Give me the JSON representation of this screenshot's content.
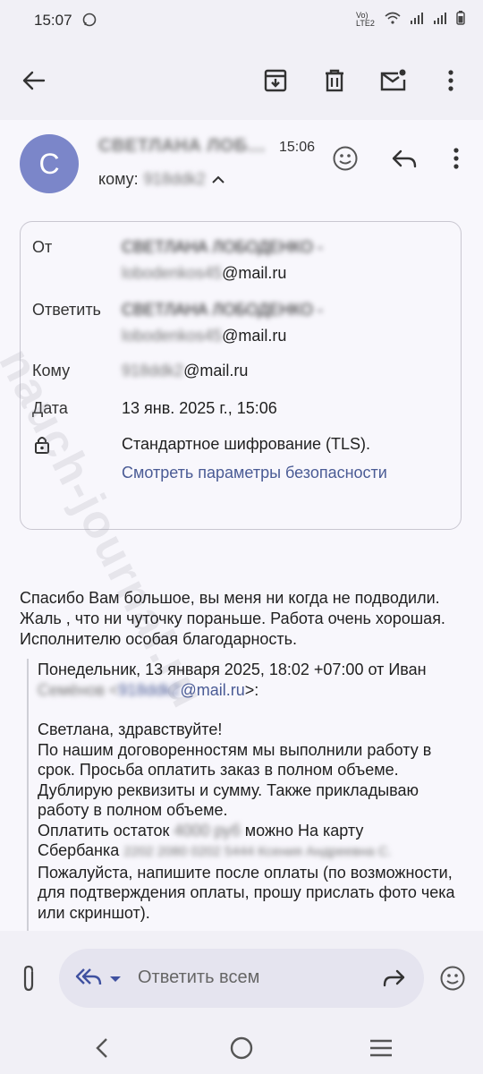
{
  "status": {
    "time": "15:07",
    "network": "Vo) LTE2"
  },
  "email": {
    "sender": "СВЕТЛАНА ЛОБ…",
    "time": "15:06",
    "to_label": "кому:",
    "to_value": "918ddk2",
    "avatar_letter": "С"
  },
  "details": {
    "from_label": "От",
    "from_line1": "СВЕТЛАНА ЛОБОДЕНКО -",
    "from_line2_blur": "lobodenkos45",
    "from_domain": "@mail.ru",
    "reply_label": "Ответить",
    "reply_line1": "СВЕТЛАНА ЛОБОДЕНКО -",
    "reply_line2_blur": "lobodenkos45",
    "reply_domain": "@mail.ru",
    "to_label": "Кому",
    "to_blur": "918ddk2",
    "to_domain": "@mail.ru",
    "date_label": "Дата",
    "date_value": "13 янв. 2025 г., 15:06",
    "encryption": "Стандартное шифрование (TLS).",
    "security_link": "Смотреть параметры безопасности"
  },
  "body": {
    "message": "Спасибо Вам большое, вы меня ни когда не подводили. Жаль , что ни чуточку пораньше. Работа очень хорошая. Исполнителю особая благодарность.",
    "quote_header": "Понедельник, 13 января 2025, 18:02 +07:00 от Иван",
    "quote_name_blur": "Семёнов <",
    "quote_email_blur": "918ddk2",
    "quote_email_domain": "@mail.ru",
    "quote_email_end": ">:",
    "quote_greeting": "Светлана, здравствуйте!",
    "quote_p1": "По нашим договоренностям мы выполнили работу в срок. Просьба оплатить заказ в полном объеме. Дублирую реквизиты и сумму. Также прикладываю работу в полном объеме.",
    "quote_p2_a": "Оплатить остаток",
    "quote_p2_blur": "4000 руб",
    "quote_p2_b": "можно На карту",
    "quote_p3_a": "Сбербанка",
    "quote_p3_blur": "2202 2080 0202 5444 Ксения Андреевна С.",
    "quote_p4": "Пожалуйста, напишите после оплаты (по возможности, для подтверждения оплаты, прошу прислать фото чека или скриншот)."
  },
  "reply": {
    "placeholder": "Ответить всем"
  },
  "watermark": "nauch-journal.ru",
  "colors": {
    "avatar": "#7b86c9",
    "link": "#4a5b95",
    "pill": "#e5e4ef"
  }
}
